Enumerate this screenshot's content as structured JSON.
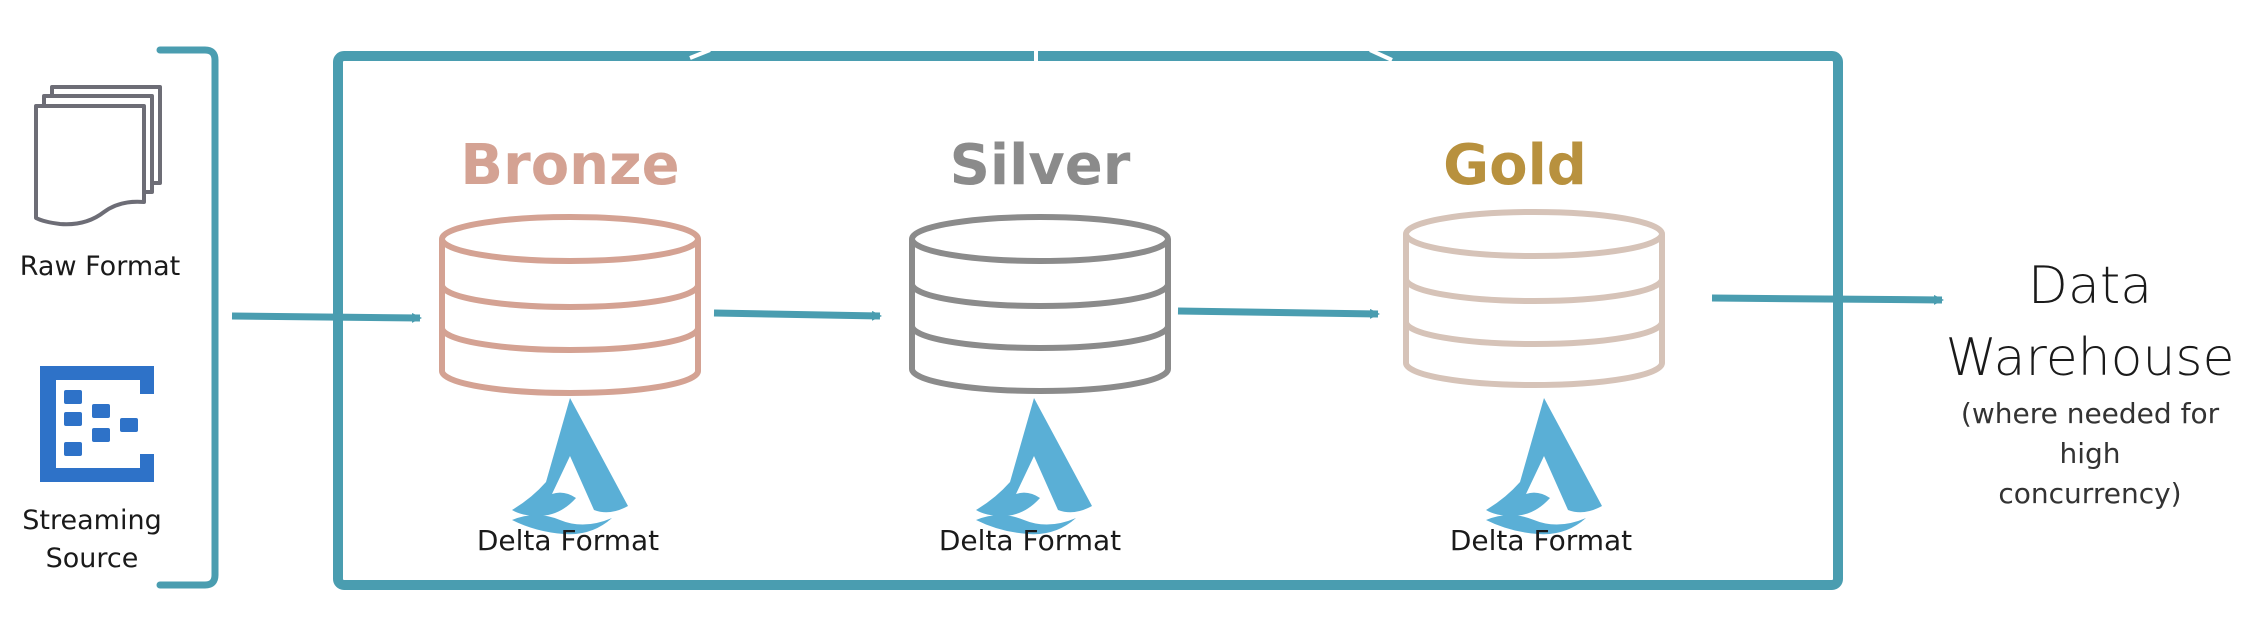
{
  "sources": {
    "raw": {
      "label": "Raw Format",
      "icon": "document-stack-icon"
    },
    "streaming": {
      "label_line1": "Streaming",
      "label_line2": "Source",
      "icon": "event-hub-icon"
    }
  },
  "tiers": [
    {
      "name": "Bronze",
      "color": "#d4a293",
      "format_label": "Delta Format"
    },
    {
      "name": "Silver",
      "color": "#8b8b8b",
      "format_label": "Delta Format"
    },
    {
      "name": "Gold",
      "color": "#b8913e",
      "cylinder_color": "#d6c3b8",
      "format_label": "Delta Format"
    }
  ],
  "destination": {
    "line1": "Data",
    "line2": "Warehouse",
    "note_line1": "(where needed for high",
    "note_line2": "concurrency)"
  },
  "colors": {
    "frame": "#4a9db0",
    "arrow": "#4a9db0",
    "delta_logo": "#5aafd6",
    "streaming_icon": "#2e72c8",
    "doc_icon": "#6d6d76"
  }
}
